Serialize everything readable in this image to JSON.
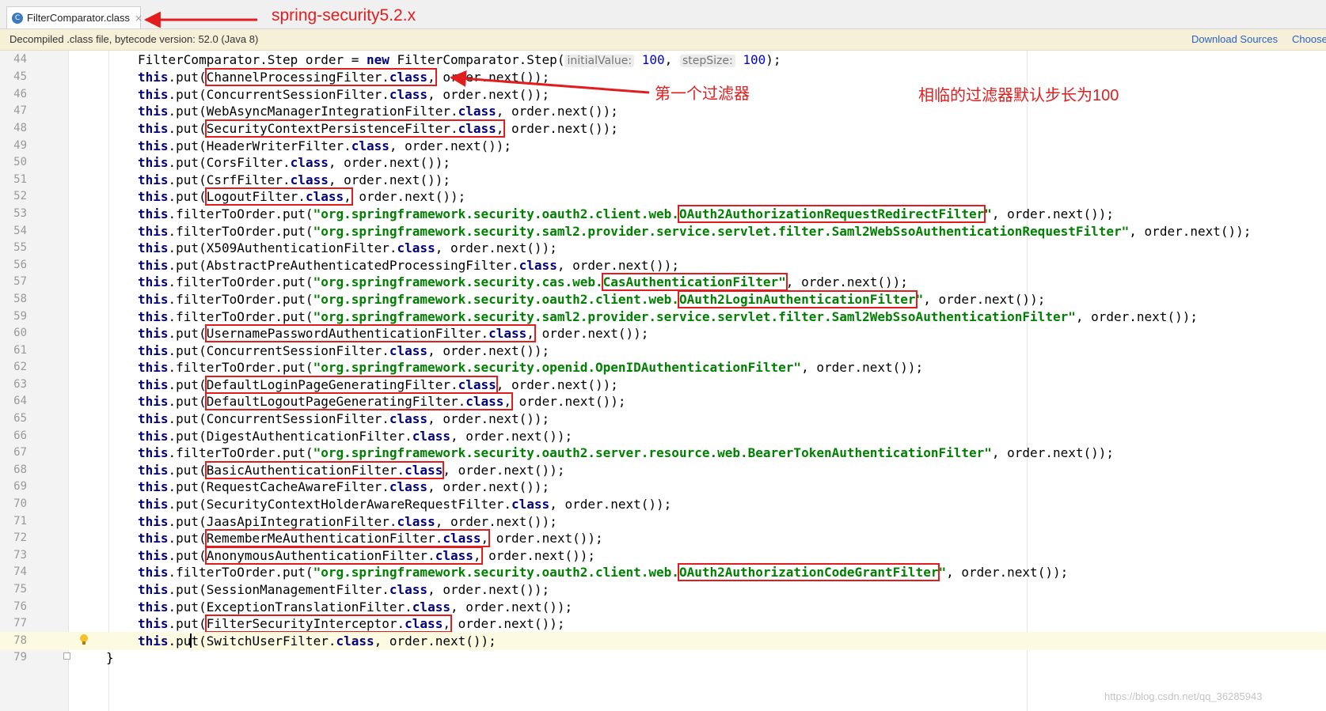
{
  "tab": {
    "icon": "class-file-icon",
    "label": "FilterComparator.class",
    "close": "×"
  },
  "banner": {
    "text": "Decompiled .class file, bytecode version: 52.0 (Java 8)",
    "download_sources": "Download Sources",
    "choose_sources": "Choose"
  },
  "annotations": {
    "version": "spring-security5.2.x",
    "first_filter": "第一个过滤器",
    "step_note": "相临的过滤器默认步长为100"
  },
  "watermark": "https://blog.csdn.net/qq_36285943",
  "code": {
    "l44": {
      "n": "44",
      "a": "FilterComparator.Step order = ",
      "kw": "new",
      "b": " FilterComparator.Step(",
      "h1": "initialValue:",
      "v1": "100",
      "c": ", ",
      "h2": "stepSize:",
      "v2": "100",
      "d": ");"
    },
    "l45": {
      "n": "45",
      "pre": "this",
      "put": ".put(",
      "box": "ChannelProcessingFilter.",
      "cls": "class",
      ",": ",",
      "rest": " order.next());"
    },
    "l46": {
      "n": "46",
      "pre": "this",
      "put": ".put(",
      "name": "ConcurrentSessionFilter.",
      "cls": "class",
      "rest": ", order.next());"
    },
    "l47": {
      "n": "47",
      "pre": "this",
      "put": ".put(",
      "name": "WebAsyncManagerIntegrationFilter.",
      "cls": "class",
      "rest": ", order.next());"
    },
    "l48": {
      "n": "48",
      "pre": "this",
      "put": ".put(",
      "box": "SecurityContextPersistenceFilter.",
      "cls": "class",
      ",": ",",
      "rest": " order.next());"
    },
    "l49": {
      "n": "49",
      "pre": "this",
      "put": ".put(",
      "name": "HeaderWriterFilter.",
      "cls": "class",
      "rest": ", order.next());"
    },
    "l50": {
      "n": "50",
      "pre": "this",
      "put": ".put(",
      "name": "CorsFilter.",
      "cls": "class",
      "rest": ", order.next());"
    },
    "l51": {
      "n": "51",
      "pre": "this",
      "put": ".put(",
      "name": "CsrfFilter.",
      "cls": "class",
      "rest": ", order.next());"
    },
    "l52": {
      "n": "52",
      "pre": "this",
      "put": ".put(",
      "box": "LogoutFilter.",
      "cls": "class",
      ",": ",",
      "rest": " order.next());"
    },
    "l53": {
      "n": "53",
      "pre": "this",
      "put": ".filterToOrder.put(",
      "s1": "\"org.springframework.security.oauth2.client.web.",
      "sbox": "OAuth2AuthorizationRequestRedirectFilter",
      "s2": "\"",
      "rest": ", order.next());"
    },
    "l54": {
      "n": "54",
      "pre": "this",
      "put": ".filterToOrder.put(",
      "s1": "\"org.springframework.security.saml2.provider.service.servlet.filter.Saml2WebSsoAuthenticationRequestFilter\"",
      "rest": ", order.next());"
    },
    "l55": {
      "n": "55",
      "pre": "this",
      "put": ".put(",
      "name": "X509AuthenticationFilter.",
      "cls": "class",
      "rest": ", order.next());"
    },
    "l56": {
      "n": "56",
      "pre": "this",
      "put": ".put(",
      "name": "AbstractPreAuthenticatedProcessingFilter.",
      "cls": "class",
      "rest": ", order.next());"
    },
    "l57": {
      "n": "57",
      "pre": "this",
      "put": ".filterToOrder.put(",
      "s1": "\"org.springframework.security.cas.web.",
      "sbox": "CasAuthenticationFilter\"",
      "rest": ", order.next());"
    },
    "l58": {
      "n": "58",
      "pre": "this",
      "put": ".filterToOrder.put(",
      "s1": "\"org.springframework.security.oauth2.client.web.",
      "sbox": "OAuth2LoginAuthenticationFilter",
      "s2": "\"",
      "rest": ", order.next());"
    },
    "l59": {
      "n": "59",
      "pre": "this",
      "put": ".filterToOrder.put(",
      "s1": "\"org.springframework.security.saml2.provider.service.servlet.filter.Saml2WebSsoAuthenticationFilter\"",
      "rest": ", order.next());"
    },
    "l60": {
      "n": "60",
      "pre": "this",
      "put": ".put(",
      "box": "UsernamePasswordAuthenticationFilter.",
      "cls": "class",
      ",": ",",
      "rest": " order.next());"
    },
    "l61": {
      "n": "61",
      "pre": "this",
      "put": ".put(",
      "name": "ConcurrentSessionFilter.",
      "cls": "class",
      "rest": ", order.next());"
    },
    "l62": {
      "n": "62",
      "pre": "this",
      "put": ".filterToOrder.put(",
      "s1": "\"org.springframework.security.openid.OpenIDAuthenticationFilter\"",
      "rest": ", order.next());"
    },
    "l63": {
      "n": "63",
      "pre": "this",
      "put": ".put(",
      "box": "DefaultLoginPageGeneratingFilter.",
      "cls": "class",
      "rest": ", order.next());"
    },
    "l64": {
      "n": "64",
      "pre": "this",
      "put": ".put(",
      "box": "DefaultLogoutPageGeneratingFilter.",
      "cls": "class",
      ",": ",",
      "rest": " order.next());"
    },
    "l65": {
      "n": "65",
      "pre": "this",
      "put": ".put(",
      "name": "ConcurrentSessionFilter.",
      "cls": "class",
      "rest": ", order.next());"
    },
    "l66": {
      "n": "66",
      "pre": "this",
      "put": ".put(",
      "name": "DigestAuthenticationFilter.",
      "cls": "class",
      "rest": ", order.next());"
    },
    "l67": {
      "n": "67",
      "pre": "this",
      "put": ".filterToOrder.put(",
      "s1": "\"org.springframework.security.oauth2.server.resource.web.BearerTokenAuthenticationFilter\"",
      "rest": ", order.next());"
    },
    "l68": {
      "n": "68",
      "pre": "this",
      "put": ".put(",
      "box": "BasicAuthenticationFilter.",
      "cls": "class",
      "rest": ", order.next());"
    },
    "l69": {
      "n": "69",
      "pre": "this",
      "put": ".put(",
      "name": "RequestCacheAwareFilter.",
      "cls": "class",
      "rest": ", order.next());"
    },
    "l70": {
      "n": "70",
      "pre": "this",
      "put": ".put(",
      "name": "SecurityContextHolderAwareRequestFilter.",
      "cls": "class",
      "rest": ", order.next());"
    },
    "l71": {
      "n": "71",
      "pre": "this",
      "put": ".put(",
      "name": "JaasApiIntegrationFilter.",
      "cls": "class",
      "rest": ", order.next());"
    },
    "l72": {
      "n": "72",
      "pre": "this",
      "put": ".put(",
      "box": "RememberMeAuthenticationFilter.",
      "cls": "class",
      ",": ",",
      "rest": " order.next());"
    },
    "l73": {
      "n": "73",
      "pre": "this",
      "put": ".put(",
      "box": "AnonymousAuthenticationFilter.",
      "cls": "class",
      ",": ",",
      "rest": " order.next());"
    },
    "l74": {
      "n": "74",
      "pre": "this",
      "put": ".filterToOrder.put(",
      "s1": "\"org.springframework.security.oauth2.client.web.",
      "sbox": "OAuth2AuthorizationCodeGrantFilter",
      "s2": "\"",
      "rest": ", order.next());"
    },
    "l75": {
      "n": "75",
      "pre": "this",
      "put": ".put(",
      "name": "SessionManagementFilter.",
      "cls": "class",
      "rest": ", order.next());"
    },
    "l76": {
      "n": "76",
      "pre": "this",
      "put": ".put(",
      "name": "ExceptionTranslationFilter.",
      "cls": "class",
      "rest": ", order.next());"
    },
    "l77": {
      "n": "77",
      "pre": "this",
      "put": ".put(",
      "box": "FilterSecurityInterceptor.",
      "cls": "class",
      ",": ",",
      "rest": " order.next());"
    },
    "l78": {
      "n": "78",
      "pre": "this",
      "put1": ".pu",
      "put2": "t(",
      "name": "SwitchUserFilter.",
      "cls": "class",
      "rest": ", order.next());"
    },
    "l79": {
      "n": "79",
      "brace": "}"
    }
  }
}
